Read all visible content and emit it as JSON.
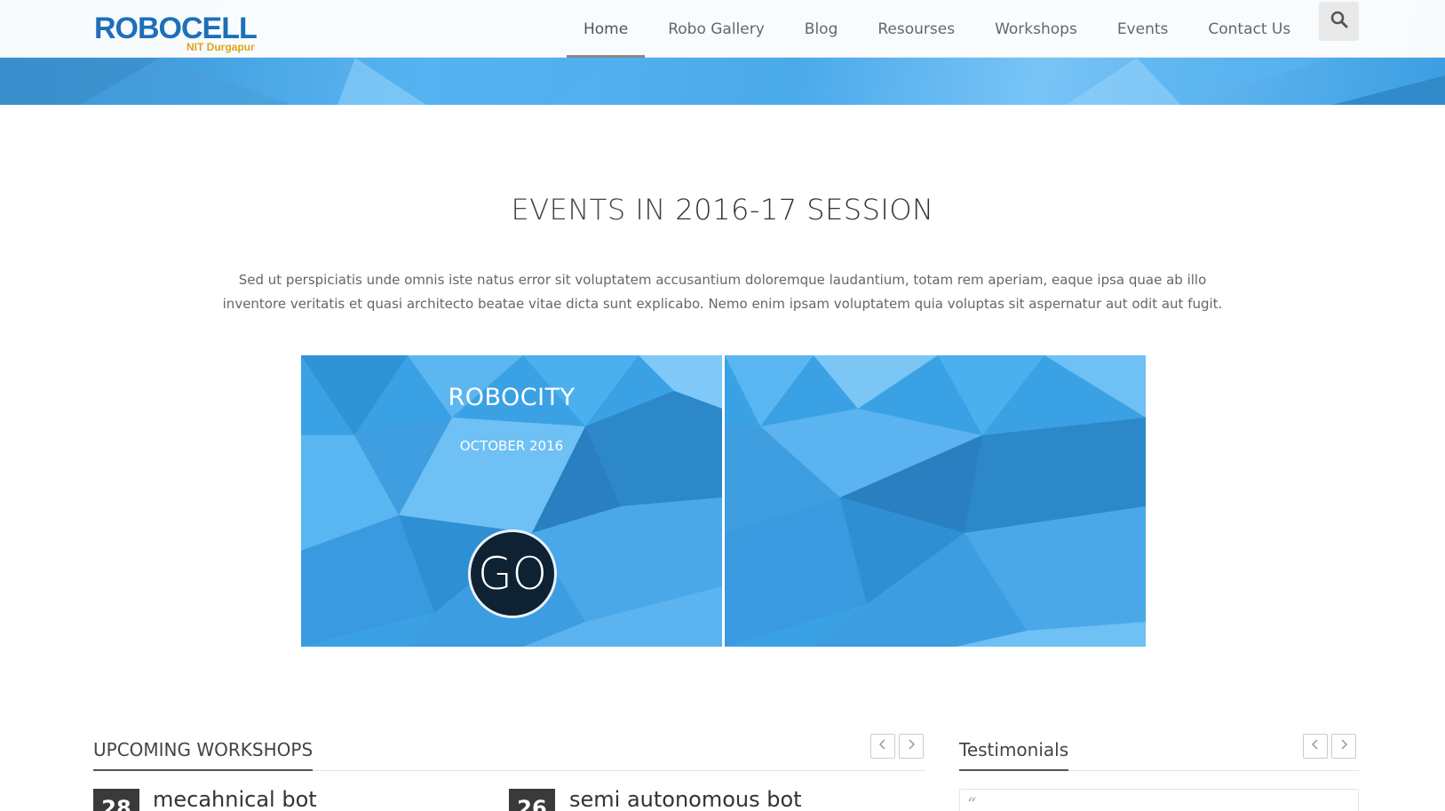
{
  "header": {
    "logo": {
      "text": "ROBOCELL",
      "subtitle": "NIT Durgapur"
    },
    "nav": [
      {
        "label": "Home",
        "active": true
      },
      {
        "label": "Robo Gallery",
        "active": false
      },
      {
        "label": "Blog",
        "active": false
      },
      {
        "label": "Resourses",
        "active": false
      },
      {
        "label": "Workshops",
        "active": false
      },
      {
        "label": "Events",
        "active": false
      },
      {
        "label": "Contact Us",
        "active": false
      }
    ],
    "search_icon": "search-icon"
  },
  "events": {
    "title_light": "EVENTS IN",
    "title_strong": "2016-17 SESSION",
    "description": "Sed ut perspiciatis unde omnis iste natus error sit voluptatem accusantium doloremque laudantium, totam rem aperiam, eaque ipsa quae ab illo inventore veritatis et quasi architecto beatae vitae dicta sunt explicabo. Nemo enim ipsam voluptatem quia voluptas sit aspernatur aut odit aut fugit.",
    "cards": [
      {
        "name": "ROBOCITY",
        "date": "OCTOBER 2016",
        "button": "GO"
      },
      {
        "name": "",
        "date": "",
        "button": ""
      }
    ]
  },
  "workshops": {
    "title": "UPCOMING WORKSHOPS",
    "items": [
      {
        "day": "28",
        "name": "mecahnical bot"
      },
      {
        "day": "26",
        "name": "semi autonomous bot"
      }
    ]
  },
  "testimonials": {
    "title": "Testimonials",
    "quote_mark": "“"
  },
  "colors": {
    "accent_blue": "#3aa2e4",
    "go_button": "#0e2233",
    "logo_blue": "#1e6fb8",
    "logo_orange": "#e2a21b"
  }
}
